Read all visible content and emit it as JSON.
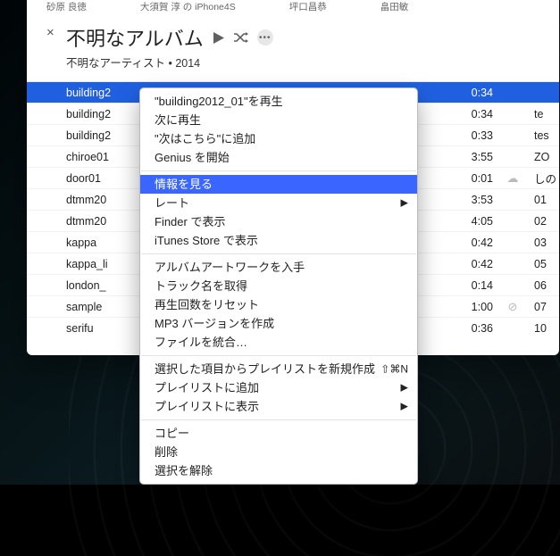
{
  "tabs": [
    "砂原 良徳",
    "大須賀 淳 の iPhone4S",
    "坪口昌恭",
    "畠田敏"
  ],
  "header": {
    "close": "×",
    "album_title": "不明なアルバム",
    "subtitle": "不明なアーティスト • 2014"
  },
  "controls": {
    "more": "•••"
  },
  "tracks": [
    {
      "name": "building2",
      "dur": "0:34",
      "icon": "",
      "extra": "",
      "selected": true
    },
    {
      "name": "building2",
      "dur": "0:34",
      "icon": "",
      "extra": "te"
    },
    {
      "name": "building2",
      "dur": "0:33",
      "icon": "",
      "extra": "tes"
    },
    {
      "name": "chiroe01",
      "dur": "3:55",
      "icon": "",
      "extra": "ZO"
    },
    {
      "name": "door01",
      "dur": "0:01",
      "icon": "☁︎",
      "extra": "しの"
    },
    {
      "name": "dtmm20",
      "dur": "3:53",
      "icon": "",
      "extra": "01"
    },
    {
      "name": "dtmm20",
      "dur": "4:05",
      "icon": "",
      "extra": "02"
    },
    {
      "name": "kappa",
      "dur": "0:42",
      "icon": "",
      "extra": "03"
    },
    {
      "name": "kappa_li",
      "dur": "0:42",
      "icon": "",
      "extra": "05"
    },
    {
      "name": "london_",
      "dur": "0:14",
      "icon": "",
      "extra": "06"
    },
    {
      "name": "sample",
      "dur": "1:00",
      "icon": "⊘",
      "extra": "07"
    },
    {
      "name": "serifu",
      "dur": "0:36",
      "icon": "",
      "extra": "10"
    }
  ],
  "menu": {
    "play_item": "\"building2012_01\"を再生",
    "play_next": "次に再生",
    "add_upnext": "\"次はこちら\"に追加",
    "genius": "Genius を開始",
    "get_info": "情報を見る",
    "rating": "レート",
    "show_finder": "Finder で表示",
    "show_store": "iTunes Store で表示",
    "get_artwork": "アルバムアートワークを入手",
    "get_trackname": "トラック名を取得",
    "reset_plays": "再生回数をリセット",
    "make_mp3": "MP3 バージョンを作成",
    "consolidate": "ファイルを統合…",
    "new_playlist": "選択した項目からプレイリストを新規作成",
    "new_playlist_shortcut": "⇧⌘N",
    "add_playlist": "プレイリストに追加",
    "show_playlist": "プレイリストに表示",
    "copy": "コピー",
    "delete": "削除",
    "deselect": "選択を解除",
    "arrow": "▶"
  }
}
